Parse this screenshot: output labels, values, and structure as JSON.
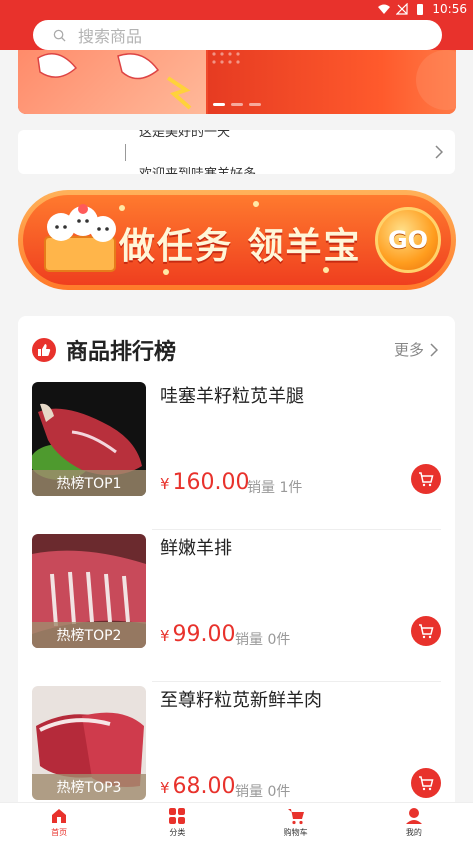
{
  "status": {
    "time": "10:56"
  },
  "search": {
    "placeholder": "搜索商品"
  },
  "notice": {
    "line1": "这是美好的一天",
    "line2": "欢迎来到哇塞羊好多"
  },
  "task_banner": {
    "title": "做任务 领羊宝",
    "go_label": "GO"
  },
  "ranking": {
    "title": "商品排行榜",
    "more_label": "更多",
    "items": [
      {
        "name": "哇塞羊籽粒苋羊腿",
        "currency": "¥",
        "price": "160.00",
        "sales": "销量 1件",
        "tag": "热榜TOP1"
      },
      {
        "name": "鲜嫩羊排",
        "currency": "¥",
        "price": "99.00",
        "sales": "销量 0件",
        "tag": "热榜TOP2"
      },
      {
        "name": "至尊籽粒苋新鲜羊肉",
        "currency": "¥",
        "price": "68.00",
        "sales": "销量 0件",
        "tag": "热榜TOP3"
      }
    ]
  },
  "tabbar": {
    "items": [
      {
        "label": "首页",
        "icon": "home-icon",
        "active": true
      },
      {
        "label": "分类",
        "icon": "category-icon",
        "active": false
      },
      {
        "label": "购物车",
        "icon": "cart-icon",
        "active": false
      },
      {
        "label": "我的",
        "icon": "user-icon",
        "active": false
      }
    ]
  },
  "colors": {
    "brand": "#e8322c",
    "price": "#e8322c"
  }
}
